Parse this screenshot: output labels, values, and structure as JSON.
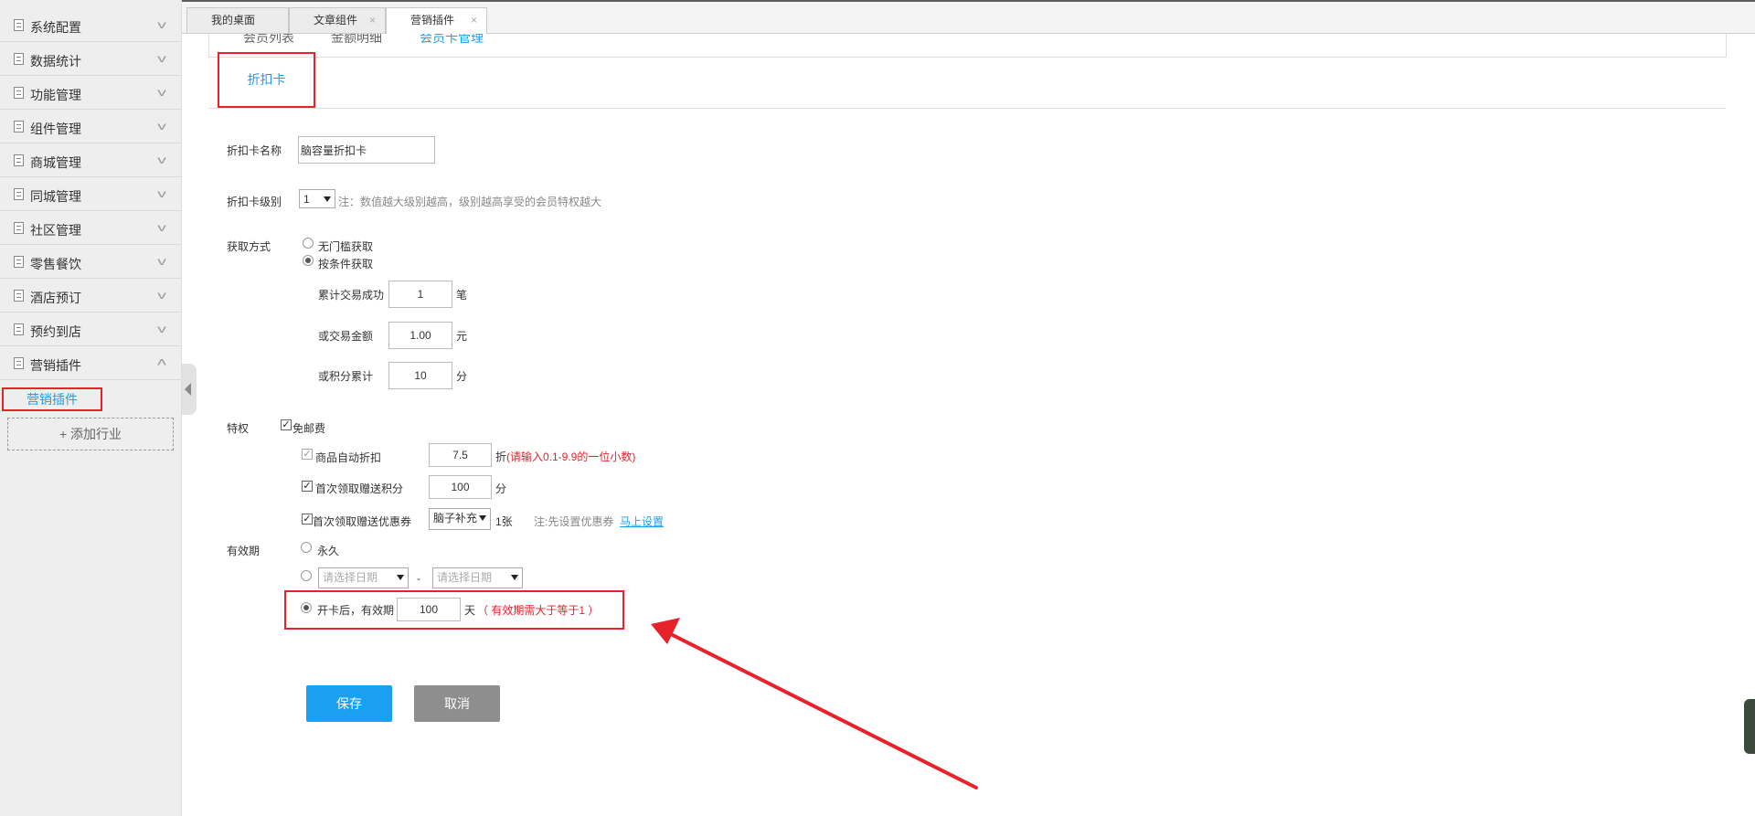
{
  "sidebar": {
    "items": [
      {
        "label": "系统配置"
      },
      {
        "label": "数据统计"
      },
      {
        "label": "功能管理"
      },
      {
        "label": "组件管理"
      },
      {
        "label": "商城管理"
      },
      {
        "label": "同城管理"
      },
      {
        "label": "社区管理"
      },
      {
        "label": "零售餐饮"
      },
      {
        "label": "酒店预订"
      },
      {
        "label": "预约到店"
      },
      {
        "label": "营销插件"
      }
    ],
    "sub_item": "营销插件",
    "add_industry": "+ 添加行业"
  },
  "tabs": [
    {
      "label": "我的桌面"
    },
    {
      "label": "文章组件",
      "close": "×"
    },
    {
      "label": "营销插件",
      "close": "×"
    }
  ],
  "subnav": {
    "links": [
      "会员列表",
      "金额明细",
      "会员卡管理"
    ]
  },
  "section_tab": "折扣卡",
  "form": {
    "name": {
      "label": "折扣卡名称",
      "value": "脑容量折扣卡"
    },
    "level": {
      "label": "折扣卡级别",
      "value": "1",
      "note": "注：数值越大级别越高，级别越高享受的会员特权越大"
    },
    "acquire": {
      "label": "获取方式",
      "option_free": "无门槛获取",
      "option_condition": "按条件获取",
      "selected": "按条件获取",
      "conditions": [
        {
          "label": "累计交易成功",
          "value": "1",
          "unit": "笔"
        },
        {
          "label": "或交易金额",
          "value": "1.00",
          "unit": "元"
        },
        {
          "label": "或积分累计",
          "value": "10",
          "unit": "分"
        }
      ]
    },
    "privilege": {
      "label": "特权",
      "free_shipping": "免邮费",
      "auto_discount": {
        "label": "商品自动折扣",
        "value": "7.5",
        "unit": "折",
        "hint": "(请输入0.1-9.9的一位小数)"
      },
      "first_points": {
        "label": "首次领取赠送积分",
        "value": "100",
        "unit": "分"
      },
      "first_coupon": {
        "label": "首次领取赠送优惠券",
        "select": "脑子补充",
        "count": "1张",
        "note": "注:先设置优惠券",
        "link": "马上设置"
      }
    },
    "validity": {
      "label": "有效期",
      "forever": "永久",
      "date_placeholder": "请选择日期",
      "dash": "-",
      "after_open": "开卡后，有效期",
      "days": "100",
      "day_unit": "天",
      "hint": "（ 有效期需大于等于1 ）"
    }
  },
  "buttons": {
    "save": "保存",
    "cancel": "取消"
  }
}
